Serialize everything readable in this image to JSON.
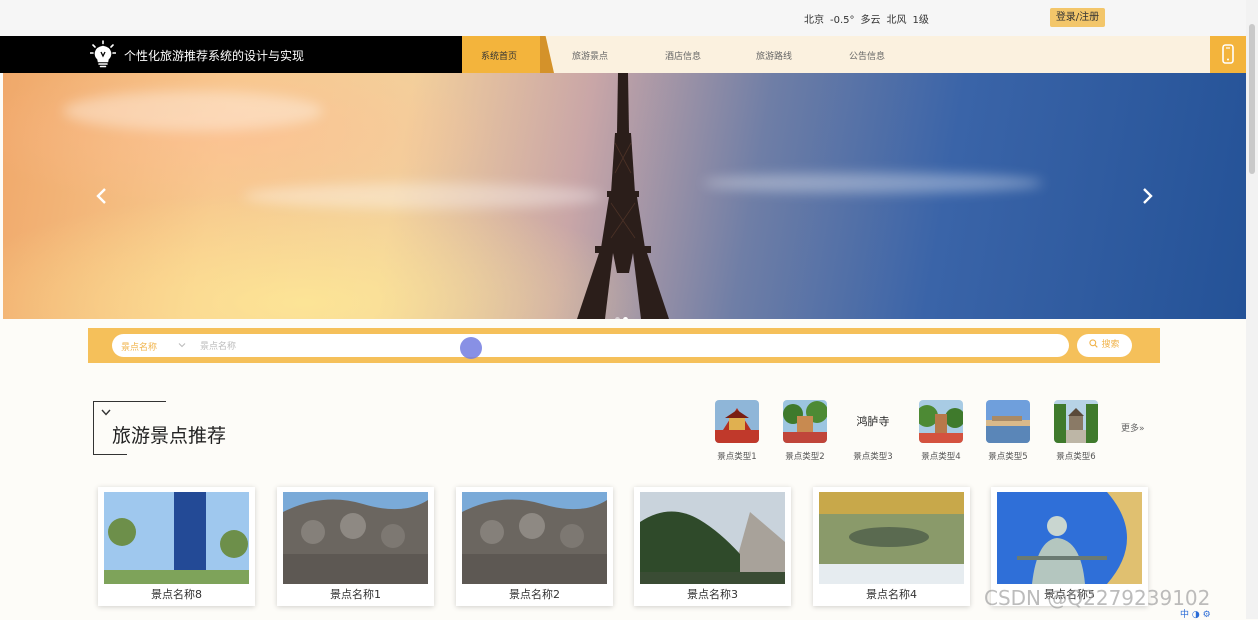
{
  "topbar": {
    "weather": [
      "北京",
      "-0.5°",
      "多云",
      "北风",
      "1级"
    ],
    "login_label": "登录/注册"
  },
  "brand": {
    "title": "个性化旅游推荐系统的设计与实现"
  },
  "nav": {
    "items": [
      "系统首页",
      "旅游景点",
      "酒店信息",
      "旅游路线",
      "公告信息"
    ],
    "active_index": 0
  },
  "banner": {
    "slide_count": 2,
    "active_slide": 1
  },
  "search": {
    "select_value": "景点名称",
    "input_placeholder": "景点名称",
    "button_label": "搜索"
  },
  "section": {
    "title": "旅游景点推荐",
    "categories": [
      "景点类型1",
      "景点类型2",
      "景点类型3",
      "景点类型4",
      "景点类型5",
      "景点类型6"
    ],
    "category_3_logo_text": "鸿胪寺",
    "more_label": "更多»"
  },
  "cards": [
    "景点名称8",
    "景点名称1",
    "景点名称2",
    "景点名称3",
    "景点名称4",
    "景点名称5"
  ],
  "watermark": "CSDN @Q2279239102",
  "tray": "中 ◑ ⚙",
  "colors": {
    "accent": "#f3b43c",
    "brand_bg": "#000000",
    "search_bg": "#f5c05a"
  }
}
